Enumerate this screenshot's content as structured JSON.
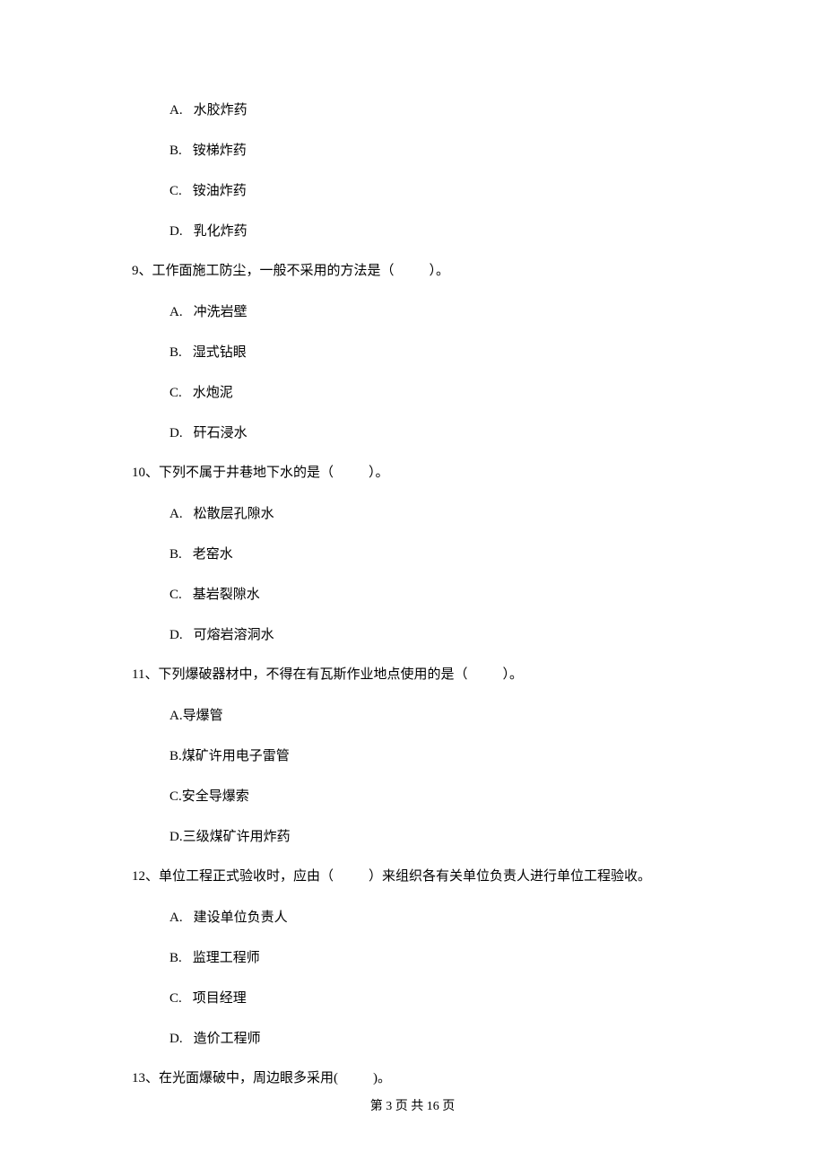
{
  "stray_options": [
    {
      "letter": "A.",
      "text": "水胶炸药"
    },
    {
      "letter": "B.",
      "text": "铵梯炸药"
    },
    {
      "letter": "C.",
      "text": "铵油炸药"
    },
    {
      "letter": "D.",
      "text": "乳化炸药"
    }
  ],
  "questions": [
    {
      "num": "9、",
      "stem_pre": "工作面施工防尘，一般不采用的方法是（",
      "stem_post": "）。",
      "opt_narrow_gap": false,
      "opts": [
        {
          "letter": "A.",
          "text": "冲洗岩壁"
        },
        {
          "letter": "B.",
          "text": "湿式钻眼"
        },
        {
          "letter": "C.",
          "text": "水炮泥"
        },
        {
          "letter": "D.",
          "text": "矸石浸水"
        }
      ]
    },
    {
      "num": "10、",
      "stem_pre": "下列不属于井巷地下水的是（",
      "stem_post": "）。",
      "opt_narrow_gap": false,
      "opts": [
        {
          "letter": "A.",
          "text": "松散层孔隙水"
        },
        {
          "letter": "B.",
          "text": "老窑水"
        },
        {
          "letter": "C.",
          "text": "基岩裂隙水"
        },
        {
          "letter": "D.",
          "text": "可熔岩溶洞水"
        }
      ]
    },
    {
      "num": "11、",
      "stem_pre": "下列爆破器材中，不得在有瓦斯作业地点使用的是（",
      "stem_post": "）。",
      "opt_narrow_gap": true,
      "opts": [
        {
          "letter": "A.",
          "text": "导爆管"
        },
        {
          "letter": "B.",
          "text": "煤矿许用电子雷管"
        },
        {
          "letter": "C.",
          "text": "安全导爆索"
        },
        {
          "letter": "D.",
          "text": "三级煤矿许用炸药"
        }
      ]
    },
    {
      "num": "12、",
      "stem_pre": "单位工程正式验收时，应由（",
      "stem_post": "）来组织各有关单位负责人进行单位工程验收。",
      "opt_narrow_gap": false,
      "opts": [
        {
          "letter": "A.",
          "text": "建设单位负责人"
        },
        {
          "letter": "B.",
          "text": "监理工程师"
        },
        {
          "letter": "C.",
          "text": "项目经理"
        },
        {
          "letter": "D.",
          "text": "造价工程师"
        }
      ]
    },
    {
      "num": "13、",
      "stem_pre": "在光面爆破中，周边眼多采用(",
      "stem_post": ")。",
      "opt_narrow_gap": false,
      "opts": []
    }
  ],
  "footer": "第 3 页 共 16 页"
}
